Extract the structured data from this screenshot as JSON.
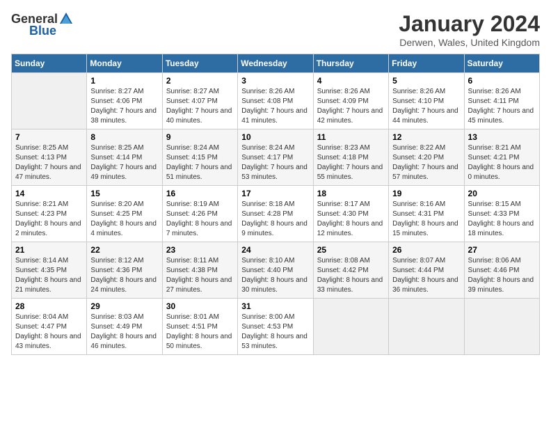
{
  "header": {
    "logo_general": "General",
    "logo_blue": "Blue",
    "title": "January 2024",
    "subtitle": "Derwen, Wales, United Kingdom"
  },
  "weekdays": [
    "Sunday",
    "Monday",
    "Tuesday",
    "Wednesday",
    "Thursday",
    "Friday",
    "Saturday"
  ],
  "weeks": [
    [
      {
        "day": "",
        "sunrise": "",
        "sunset": "",
        "daylight": "",
        "empty": true
      },
      {
        "day": "1",
        "sunrise": "Sunrise: 8:27 AM",
        "sunset": "Sunset: 4:06 PM",
        "daylight": "Daylight: 7 hours and 38 minutes."
      },
      {
        "day": "2",
        "sunrise": "Sunrise: 8:27 AM",
        "sunset": "Sunset: 4:07 PM",
        "daylight": "Daylight: 7 hours and 40 minutes."
      },
      {
        "day": "3",
        "sunrise": "Sunrise: 8:26 AM",
        "sunset": "Sunset: 4:08 PM",
        "daylight": "Daylight: 7 hours and 41 minutes."
      },
      {
        "day": "4",
        "sunrise": "Sunrise: 8:26 AM",
        "sunset": "Sunset: 4:09 PM",
        "daylight": "Daylight: 7 hours and 42 minutes."
      },
      {
        "day": "5",
        "sunrise": "Sunrise: 8:26 AM",
        "sunset": "Sunset: 4:10 PM",
        "daylight": "Daylight: 7 hours and 44 minutes."
      },
      {
        "day": "6",
        "sunrise": "Sunrise: 8:26 AM",
        "sunset": "Sunset: 4:11 PM",
        "daylight": "Daylight: 7 hours and 45 minutes."
      }
    ],
    [
      {
        "day": "7",
        "sunrise": "Sunrise: 8:25 AM",
        "sunset": "Sunset: 4:13 PM",
        "daylight": "Daylight: 7 hours and 47 minutes."
      },
      {
        "day": "8",
        "sunrise": "Sunrise: 8:25 AM",
        "sunset": "Sunset: 4:14 PM",
        "daylight": "Daylight: 7 hours and 49 minutes."
      },
      {
        "day": "9",
        "sunrise": "Sunrise: 8:24 AM",
        "sunset": "Sunset: 4:15 PM",
        "daylight": "Daylight: 7 hours and 51 minutes."
      },
      {
        "day": "10",
        "sunrise": "Sunrise: 8:24 AM",
        "sunset": "Sunset: 4:17 PM",
        "daylight": "Daylight: 7 hours and 53 minutes."
      },
      {
        "day": "11",
        "sunrise": "Sunrise: 8:23 AM",
        "sunset": "Sunset: 4:18 PM",
        "daylight": "Daylight: 7 hours and 55 minutes."
      },
      {
        "day": "12",
        "sunrise": "Sunrise: 8:22 AM",
        "sunset": "Sunset: 4:20 PM",
        "daylight": "Daylight: 7 hours and 57 minutes."
      },
      {
        "day": "13",
        "sunrise": "Sunrise: 8:21 AM",
        "sunset": "Sunset: 4:21 PM",
        "daylight": "Daylight: 8 hours and 0 minutes."
      }
    ],
    [
      {
        "day": "14",
        "sunrise": "Sunrise: 8:21 AM",
        "sunset": "Sunset: 4:23 PM",
        "daylight": "Daylight: 8 hours and 2 minutes."
      },
      {
        "day": "15",
        "sunrise": "Sunrise: 8:20 AM",
        "sunset": "Sunset: 4:25 PM",
        "daylight": "Daylight: 8 hours and 4 minutes."
      },
      {
        "day": "16",
        "sunrise": "Sunrise: 8:19 AM",
        "sunset": "Sunset: 4:26 PM",
        "daylight": "Daylight: 8 hours and 7 minutes."
      },
      {
        "day": "17",
        "sunrise": "Sunrise: 8:18 AM",
        "sunset": "Sunset: 4:28 PM",
        "daylight": "Daylight: 8 hours and 9 minutes."
      },
      {
        "day": "18",
        "sunrise": "Sunrise: 8:17 AM",
        "sunset": "Sunset: 4:30 PM",
        "daylight": "Daylight: 8 hours and 12 minutes."
      },
      {
        "day": "19",
        "sunrise": "Sunrise: 8:16 AM",
        "sunset": "Sunset: 4:31 PM",
        "daylight": "Daylight: 8 hours and 15 minutes."
      },
      {
        "day": "20",
        "sunrise": "Sunrise: 8:15 AM",
        "sunset": "Sunset: 4:33 PM",
        "daylight": "Daylight: 8 hours and 18 minutes."
      }
    ],
    [
      {
        "day": "21",
        "sunrise": "Sunrise: 8:14 AM",
        "sunset": "Sunset: 4:35 PM",
        "daylight": "Daylight: 8 hours and 21 minutes."
      },
      {
        "day": "22",
        "sunrise": "Sunrise: 8:12 AM",
        "sunset": "Sunset: 4:36 PM",
        "daylight": "Daylight: 8 hours and 24 minutes."
      },
      {
        "day": "23",
        "sunrise": "Sunrise: 8:11 AM",
        "sunset": "Sunset: 4:38 PM",
        "daylight": "Daylight: 8 hours and 27 minutes."
      },
      {
        "day": "24",
        "sunrise": "Sunrise: 8:10 AM",
        "sunset": "Sunset: 4:40 PM",
        "daylight": "Daylight: 8 hours and 30 minutes."
      },
      {
        "day": "25",
        "sunrise": "Sunrise: 8:08 AM",
        "sunset": "Sunset: 4:42 PM",
        "daylight": "Daylight: 8 hours and 33 minutes."
      },
      {
        "day": "26",
        "sunrise": "Sunrise: 8:07 AM",
        "sunset": "Sunset: 4:44 PM",
        "daylight": "Daylight: 8 hours and 36 minutes."
      },
      {
        "day": "27",
        "sunrise": "Sunrise: 8:06 AM",
        "sunset": "Sunset: 4:46 PM",
        "daylight": "Daylight: 8 hours and 39 minutes."
      }
    ],
    [
      {
        "day": "28",
        "sunrise": "Sunrise: 8:04 AM",
        "sunset": "Sunset: 4:47 PM",
        "daylight": "Daylight: 8 hours and 43 minutes."
      },
      {
        "day": "29",
        "sunrise": "Sunrise: 8:03 AM",
        "sunset": "Sunset: 4:49 PM",
        "daylight": "Daylight: 8 hours and 46 minutes."
      },
      {
        "day": "30",
        "sunrise": "Sunrise: 8:01 AM",
        "sunset": "Sunset: 4:51 PM",
        "daylight": "Daylight: 8 hours and 50 minutes."
      },
      {
        "day": "31",
        "sunrise": "Sunrise: 8:00 AM",
        "sunset": "Sunset: 4:53 PM",
        "daylight": "Daylight: 8 hours and 53 minutes."
      },
      {
        "day": "",
        "sunrise": "",
        "sunset": "",
        "daylight": "",
        "empty": true
      },
      {
        "day": "",
        "sunrise": "",
        "sunset": "",
        "daylight": "",
        "empty": true
      },
      {
        "day": "",
        "sunrise": "",
        "sunset": "",
        "daylight": "",
        "empty": true
      }
    ]
  ]
}
